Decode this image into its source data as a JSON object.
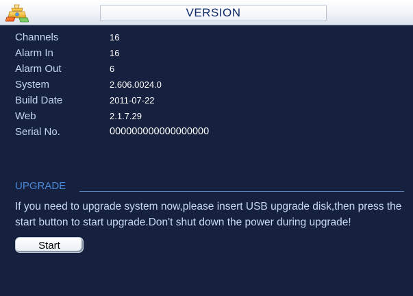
{
  "window": {
    "title": "VERSION",
    "logo_icon": "dvr-logo-icon"
  },
  "info": {
    "rows": [
      {
        "label": "Channels",
        "value": "16"
      },
      {
        "label": "Alarm In",
        "value": "16"
      },
      {
        "label": "Alarm Out",
        "value": "6"
      },
      {
        "label": "System",
        "value": "2.606.0024.0"
      },
      {
        "label": "Build Date",
        "value": "2011-07-22"
      },
      {
        "label": "Web",
        "value": "2.1.7.29"
      },
      {
        "label": "Serial No.",
        "value": "000000000000000000"
      }
    ]
  },
  "upgrade": {
    "section_title": "UPGRADE",
    "message": "If you need to upgrade system now,please insert USB upgrade disk,then press the start button to start upgrade.Don't shut down the power during upgrade!",
    "start_label": "Start"
  },
  "colors": {
    "background": "#16213f",
    "label_text": "#c5d7f3",
    "value_text": "#ffffff",
    "section_accent": "#4d8ad8",
    "title_text": "#0d2a6b"
  }
}
